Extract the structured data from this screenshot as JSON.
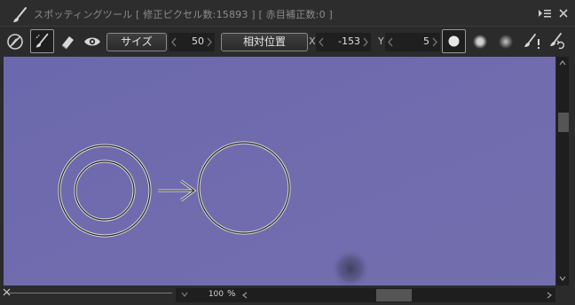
{
  "window": {
    "title": "スポッティングツール",
    "modified_label": "修正ピクセル数",
    "modified_value": "15893",
    "redeye_label": "赤目補正数",
    "redeye_value": "0"
  },
  "toolbar": {
    "size_button": "サイズ",
    "size_value": "50",
    "position_button": "相対位置",
    "x_label": "X",
    "x_value": "-153",
    "y_label": "Y",
    "y_value": "5"
  },
  "footer": {
    "zoom_value": "100",
    "zoom_unit": "%"
  },
  "colors": {
    "canvas": "#6e6aae",
    "panel": "#2b2b2b"
  },
  "icons": [
    "brush-icon",
    "menu-icon",
    "close-icon",
    "no-brush-icon",
    "spot-brush-icon",
    "eraser-icon",
    "eye-icon",
    "hard-brush-icon",
    "medium-brush-icon",
    "soft-brush-icon",
    "warning-brush-icon",
    "undo-brush-icon"
  ]
}
